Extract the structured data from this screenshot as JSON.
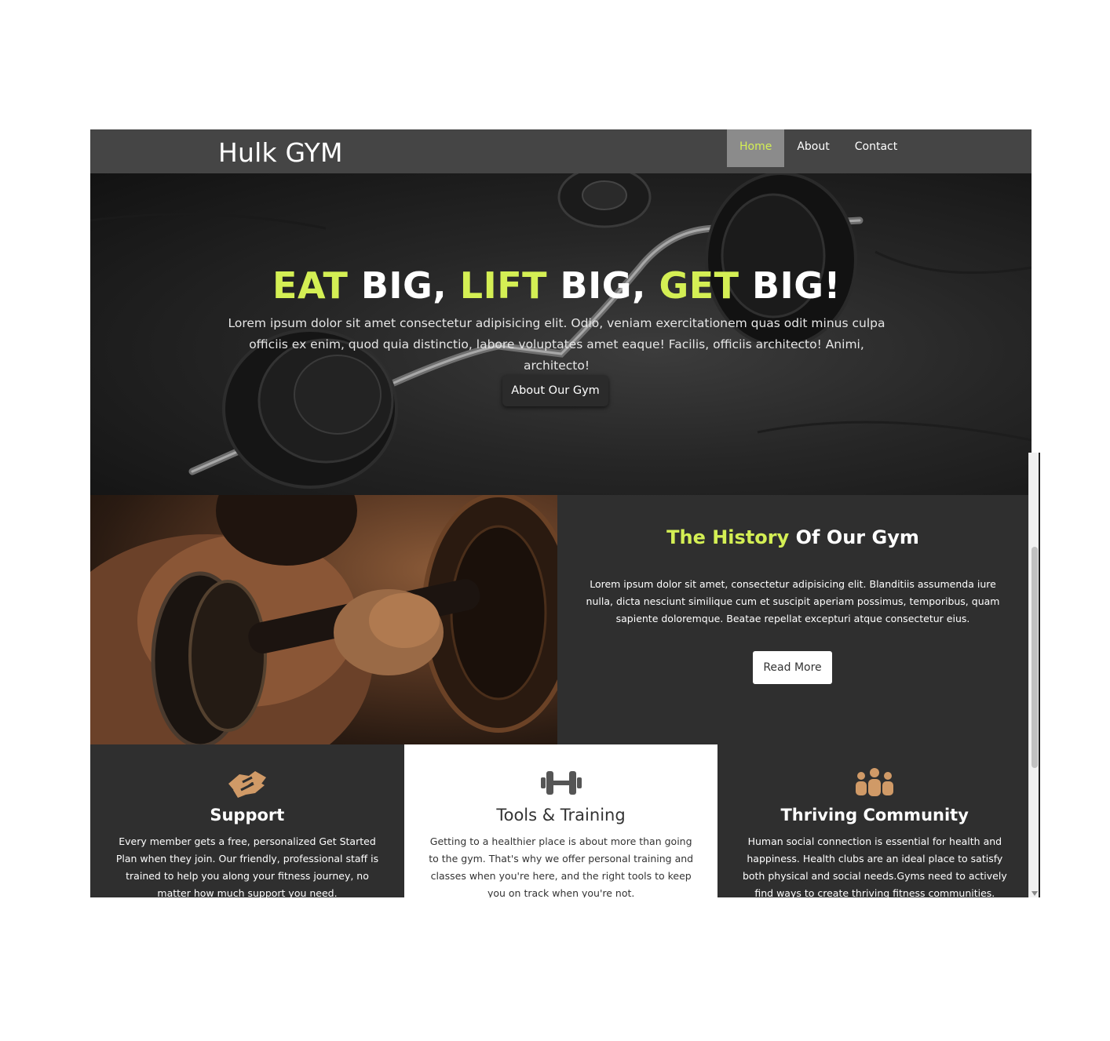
{
  "navbar": {
    "brand": "Hulk GYM",
    "items": [
      {
        "label": "Home",
        "active": true
      },
      {
        "label": "About",
        "active": false
      },
      {
        "label": "Contact",
        "active": false
      }
    ]
  },
  "hero": {
    "title_parts": [
      {
        "text": "EAT",
        "accent": true
      },
      {
        "text": " BIG, ",
        "accent": false
      },
      {
        "text": "LIFT",
        "accent": true
      },
      {
        "text": " BIG, ",
        "accent": false
      },
      {
        "text": "GET",
        "accent": true
      },
      {
        "text": " BIG!",
        "accent": false
      }
    ],
    "text": "Lorem ipsum dolor sit amet consectetur adipisicing elit. Odio, veniam exercitationem quas odit minus culpa officiis ex enim, quod quia distinctio, labore voluptates amet eaque! Facilis, officiis architecto! Animi, architecto!",
    "button": "About Our Gym"
  },
  "history": {
    "title_accent": "The History",
    "title_rest": " Of Our Gym",
    "text": "Lorem ipsum dolor sit amet, consectetur adipisicing elit. Blanditiis assumenda iure nulla, dicta nesciunt similique cum et suscipit aperiam possimus, temporibus, quam sapiente doloremque. Beatae repellat excepturi atque consectetur eius.",
    "button": "Read More"
  },
  "features": [
    {
      "icon": "handshake-icon",
      "title": "Support",
      "text": "Every member gets a free, personalized Get Started Plan when they join. Our friendly, professional staff is trained to help you along your fitness journey, no matter how much support you need."
    },
    {
      "icon": "dumbbell-icon",
      "title": "Tools & Training",
      "text": "Getting to a healthier place is about more than going to the gym. That's why we offer personal training and classes when you're here, and the right tools to keep you on track when you're not."
    },
    {
      "icon": "community-icon",
      "title": "Thriving Community",
      "text": "Human social connection is essential for health and happiness. Health clubs are an ideal place to satisfy both physical and social needs.Gyms need to actively find ways to create thriving fitness communities."
    }
  ],
  "colors": {
    "accent": "#d4ef54",
    "navbar_bg": "#454545",
    "section_bg": "#2f2f2f",
    "icon_tan": "#d09a67",
    "icon_gray": "#555555"
  }
}
